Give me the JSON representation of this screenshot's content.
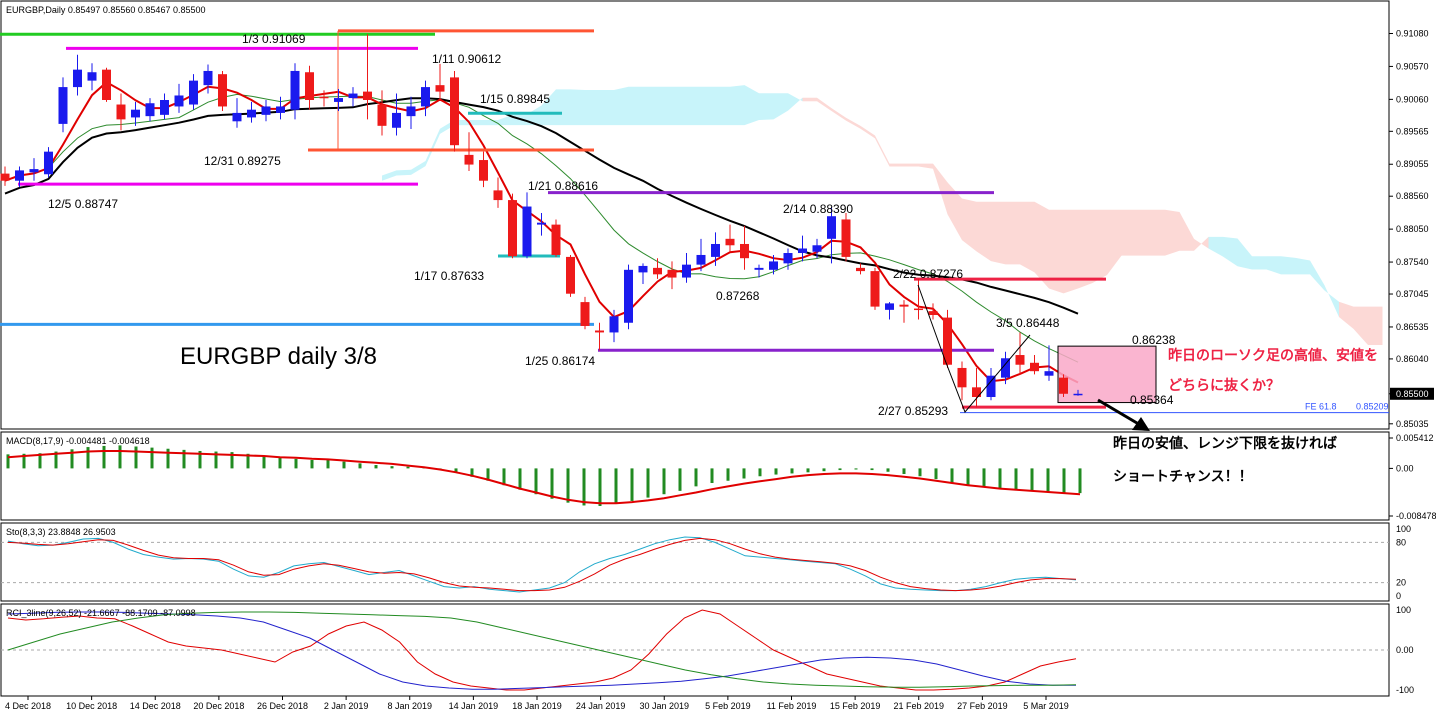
{
  "chart_data": {
    "type": "candlestick",
    "symbol_header": "EURGBP,Daily  0.85497 0.85560 0.85467 0.85500",
    "title": "EURGBP daily 3/8",
    "last_price": "0.85500",
    "price_axis_ticks": [
      "0.91080",
      "0.90570",
      "0.90060",
      "0.89565",
      "0.89055",
      "0.88560",
      "0.88050",
      "0.87540",
      "0.87045",
      "0.86535",
      "0.86040",
      "0.85500",
      "0.85035"
    ],
    "price_range": [
      0.8497,
      0.9132
    ],
    "date_labels": [
      "4 Dec 2018",
      "10 Dec 2018",
      "14 Dec 2018",
      "20 Dec 2018",
      "26 Dec 2018",
      "2 Jan 2019",
      "8 Jan 2019",
      "14 Jan 2019",
      "18 Jan 2019",
      "24 Jan 2019",
      "30 Jan 2019",
      "5 Feb 2019",
      "11 Feb 2019",
      "15 Feb 2019",
      "21 Feb 2019",
      "27 Feb 2019",
      "5 Mar 2019"
    ],
    "candles": [
      {
        "o": 0.8891,
        "h": 0.8902,
        "l": 0.8872,
        "c": 0.888
      },
      {
        "o": 0.888,
        "h": 0.8902,
        "l": 0.887,
        "c": 0.8896
      },
      {
        "o": 0.8893,
        "h": 0.8915,
        "l": 0.888,
        "c": 0.8898
      },
      {
        "o": 0.889,
        "h": 0.8932,
        "l": 0.8885,
        "c": 0.8925
      },
      {
        "o": 0.8968,
        "h": 0.904,
        "l": 0.8955,
        "c": 0.9025
      },
      {
        "o": 0.9025,
        "h": 0.9075,
        "l": 0.9012,
        "c": 0.9052
      },
      {
        "o": 0.9035,
        "h": 0.9062,
        "l": 0.902,
        "c": 0.9048
      },
      {
        "o": 0.9052,
        "h": 0.9055,
        "l": 0.9002,
        "c": 0.9005
      },
      {
        "o": 0.8998,
        "h": 0.9015,
        "l": 0.8958,
        "c": 0.8975
      },
      {
        "o": 0.8978,
        "h": 0.9002,
        "l": 0.8965,
        "c": 0.899
      },
      {
        "o": 0.898,
        "h": 0.9008,
        "l": 0.8972,
        "c": 0.9
      },
      {
        "o": 0.8982,
        "h": 0.9015,
        "l": 0.8975,
        "c": 0.9005
      },
      {
        "o": 0.8995,
        "h": 0.903,
        "l": 0.8985,
        "c": 0.9012
      },
      {
        "o": 0.8998,
        "h": 0.9045,
        "l": 0.899,
        "c": 0.9035
      },
      {
        "o": 0.9028,
        "h": 0.906,
        "l": 0.9015,
        "c": 0.905
      },
      {
        "o": 0.9045,
        "h": 0.905,
        "l": 0.8988,
        "c": 0.8995
      },
      {
        "o": 0.8972,
        "h": 0.9008,
        "l": 0.8962,
        "c": 0.8985
      },
      {
        "o": 0.8978,
        "h": 0.9002,
        "l": 0.897,
        "c": 0.899
      },
      {
        "o": 0.8982,
        "h": 0.9005,
        "l": 0.8972,
        "c": 0.8995
      },
      {
        "o": 0.8985,
        "h": 0.901,
        "l": 0.8975,
        "c": 0.8995
      },
      {
        "o": 0.899,
        "h": 0.9062,
        "l": 0.8975,
        "c": 0.905
      },
      {
        "o": 0.9048,
        "h": 0.9058,
        "l": 0.899,
        "c": 0.9005
      },
      {
        "o": 0.901,
        "h": 0.902,
        "l": 0.8995,
        "c": 0.9008
      },
      {
        "o": 0.9002,
        "h": 0.9022,
        "l": 0.8988,
        "c": 0.9008
      },
      {
        "o": 0.9008,
        "h": 0.9025,
        "l": 0.8995,
        "c": 0.9015
      },
      {
        "o": 0.9018,
        "h": 0.9107,
        "l": 0.8975,
        "c": 0.9005
      },
      {
        "o": 0.8998,
        "h": 0.902,
        "l": 0.895,
        "c": 0.8965
      },
      {
        "o": 0.8962,
        "h": 0.9015,
        "l": 0.895,
        "c": 0.8985
      },
      {
        "o": 0.898,
        "h": 0.901,
        "l": 0.896,
        "c": 0.8995
      },
      {
        "o": 0.8995,
        "h": 0.9035,
        "l": 0.898,
        "c": 0.9025
      },
      {
        "o": 0.9028,
        "h": 0.9061,
        "l": 0.9005,
        "c": 0.9018
      },
      {
        "o": 0.904,
        "h": 0.905,
        "l": 0.8925,
        "c": 0.8935
      },
      {
        "o": 0.892,
        "h": 0.8955,
        "l": 0.8895,
        "c": 0.8905
      },
      {
        "o": 0.8912,
        "h": 0.8925,
        "l": 0.887,
        "c": 0.888
      },
      {
        "o": 0.8865,
        "h": 0.8885,
        "l": 0.8838,
        "c": 0.885
      },
      {
        "o": 0.885,
        "h": 0.886,
        "l": 0.876,
        "c": 0.8763
      },
      {
        "o": 0.8763,
        "h": 0.8862,
        "l": 0.876,
        "c": 0.884
      },
      {
        "o": 0.8812,
        "h": 0.883,
        "l": 0.8795,
        "c": 0.8815
      },
      {
        "o": 0.8812,
        "h": 0.882,
        "l": 0.8762,
        "c": 0.8765
      },
      {
        "o": 0.8762,
        "h": 0.8765,
        "l": 0.87,
        "c": 0.8705
      },
      {
        "o": 0.8692,
        "h": 0.87,
        "l": 0.865,
        "c": 0.8655
      },
      {
        "o": 0.8648,
        "h": 0.866,
        "l": 0.8617,
        "c": 0.8645
      },
      {
        "o": 0.8645,
        "h": 0.868,
        "l": 0.863,
        "c": 0.867
      },
      {
        "o": 0.866,
        "h": 0.875,
        "l": 0.865,
        "c": 0.8742
      },
      {
        "o": 0.8738,
        "h": 0.8752,
        "l": 0.872,
        "c": 0.8748
      },
      {
        "o": 0.8745,
        "h": 0.876,
        "l": 0.8728,
        "c": 0.8735
      },
      {
        "o": 0.8742,
        "h": 0.8755,
        "l": 0.8712,
        "c": 0.873
      },
      {
        "o": 0.873,
        "h": 0.8768,
        "l": 0.8722,
        "c": 0.875
      },
      {
        "o": 0.875,
        "h": 0.879,
        "l": 0.874,
        "c": 0.8765
      },
      {
        "o": 0.8762,
        "h": 0.88,
        "l": 0.8748,
        "c": 0.8782
      },
      {
        "o": 0.879,
        "h": 0.8812,
        "l": 0.877,
        "c": 0.878
      },
      {
        "o": 0.8782,
        "h": 0.881,
        "l": 0.8742,
        "c": 0.876
      },
      {
        "o": 0.8742,
        "h": 0.875,
        "l": 0.873,
        "c": 0.8745
      },
      {
        "o": 0.8742,
        "h": 0.8765,
        "l": 0.8735,
        "c": 0.8755
      },
      {
        "o": 0.8752,
        "h": 0.8775,
        "l": 0.8742,
        "c": 0.8768
      },
      {
        "o": 0.8768,
        "h": 0.8795,
        "l": 0.8755,
        "c": 0.8775
      },
      {
        "o": 0.877,
        "h": 0.879,
        "l": 0.876,
        "c": 0.878
      },
      {
        "o": 0.879,
        "h": 0.8839,
        "l": 0.8752,
        "c": 0.8825
      },
      {
        "o": 0.882,
        "h": 0.883,
        "l": 0.8755,
        "c": 0.8762
      },
      {
        "o": 0.8745,
        "h": 0.8752,
        "l": 0.8735,
        "c": 0.874
      },
      {
        "o": 0.874,
        "h": 0.8745,
        "l": 0.868,
        "c": 0.8685
      },
      {
        "o": 0.868,
        "h": 0.8692,
        "l": 0.8665,
        "c": 0.869
      },
      {
        "o": 0.8688,
        "h": 0.8695,
        "l": 0.866,
        "c": 0.8685
      },
      {
        "o": 0.8682,
        "h": 0.8728,
        "l": 0.8665,
        "c": 0.868
      },
      {
        "o": 0.8678,
        "h": 0.869,
        "l": 0.8665,
        "c": 0.8672
      },
      {
        "o": 0.8668,
        "h": 0.868,
        "l": 0.859,
        "c": 0.8595
      },
      {
        "o": 0.859,
        "h": 0.86,
        "l": 0.854,
        "c": 0.856
      },
      {
        "o": 0.856,
        "h": 0.859,
        "l": 0.8529,
        "c": 0.8545
      },
      {
        "o": 0.8545,
        "h": 0.859,
        "l": 0.854,
        "c": 0.8578
      },
      {
        "o": 0.8575,
        "h": 0.8615,
        "l": 0.8565,
        "c": 0.8605
      },
      {
        "o": 0.861,
        "h": 0.8645,
        "l": 0.858,
        "c": 0.8595
      },
      {
        "o": 0.8598,
        "h": 0.861,
        "l": 0.858,
        "c": 0.8585
      },
      {
        "o": 0.8578,
        "h": 0.8625,
        "l": 0.857,
        "c": 0.8585
      },
      {
        "o": 0.8575,
        "h": 0.858,
        "l": 0.8545,
        "c": 0.855
      },
      {
        "o": 0.855,
        "h": 0.8556,
        "l": 0.8547,
        "c": 0.855
      }
    ],
    "levels": [
      {
        "label": "1/3 0.91069",
        "price": 0.91069,
        "color": "#22cc22"
      },
      {
        "label": "1/11 0.90612",
        "price": 0.90612,
        "color": "#ff5533"
      },
      {
        "label": "12/31 0.89275",
        "price": 0.89275,
        "color": "#ff5533"
      },
      {
        "label": "12/5 0.88747",
        "price": 0.88747,
        "color": "#ee00ee"
      },
      {
        "label": "1/15 0.89845",
        "price": 0.89845,
        "color": "#22bbbb"
      },
      {
        "label": "1/21 0.88616",
        "price": 0.88616,
        "color": "#8822cc"
      },
      {
        "label": "1/17 0.87633",
        "price": 0.87633,
        "color": "#22bbbb"
      },
      {
        "label": "1/25 0.86174",
        "price": 0.86174,
        "color": "#8822cc"
      },
      {
        "label": "2/14 0.88390",
        "price": 0.8839,
        "color": "#000000"
      },
      {
        "label": "0.87268",
        "price": 0.87268,
        "color": "#000000"
      },
      {
        "label": "2/22 0.87276",
        "price": 0.87276,
        "color": "#ee2244"
      },
      {
        "label": "3/5 0.86448",
        "price": 0.86448,
        "color": "#000000"
      },
      {
        "label": "0.86238",
        "price": 0.86238,
        "color": "#000000"
      },
      {
        "label": "0.85364",
        "price": 0.85364,
        "color": "#000000"
      },
      {
        "label": "2/27 0.85293",
        "price": 0.85293,
        "color": "#ee2244"
      }
    ],
    "fe_label": "FE 61.8",
    "fe_value": "0.85209",
    "annotation_jp_1": "昨日のローソク足の高値、安値を",
    "annotation_jp_2": "どちらに抜くか？",
    "annotation_jp_3": "昨日の安値、レンジ下限を抜ければ",
    "annotation_jp_4": "ショートチャンス！！",
    "macd": {
      "header": "MACD(8,17,9) -0.004481 -0.004618",
      "ticks": [
        "0.005412",
        "0.00",
        "-0.008478"
      ],
      "hist": [
        0.0025,
        0.0026,
        0.0027,
        0.003,
        0.0034,
        0.0038,
        0.004,
        0.0041,
        0.0039,
        0.0037,
        0.0035,
        0.0033,
        0.0031,
        0.003,
        0.0029,
        0.0026,
        0.0022,
        0.0019,
        0.0017,
        0.0015,
        0.0015,
        0.0012,
        0.0009,
        0.0006,
        0.0004,
        0.0003,
        0.0001,
        -0.0003,
        -0.0008,
        -0.0015,
        -0.0022,
        -0.003,
        -0.0038,
        -0.0046,
        -0.0054,
        -0.0061,
        -0.0066,
        -0.0067,
        -0.0063,
        -0.0058,
        -0.0052,
        -0.0046,
        -0.004,
        -0.0032,
        -0.0026,
        -0.0022,
        -0.0018,
        -0.0014,
        -0.0011,
        -0.0009,
        -0.0007,
        -0.0005,
        -0.0003,
        -0.0002,
        -0.0003,
        -0.0006,
        -0.001,
        -0.0014,
        -0.0019,
        -0.0025,
        -0.003,
        -0.0033,
        -0.0035,
        -0.0037,
        -0.0039,
        -0.0041,
        -0.0043,
        -0.0044
      ],
      "signal": [
        0.002,
        0.0022,
        0.0024,
        0.0026,
        0.0028,
        0.003,
        0.0031,
        0.0031,
        0.003,
        0.0029,
        0.0028,
        0.0027,
        0.0026,
        0.0025,
        0.0024,
        0.0023,
        0.0022,
        0.002,
        0.0019,
        0.0017,
        0.0016,
        0.0014,
        0.0012,
        0.001,
        0.0008,
        0.0005,
        0.0002,
        -0.0002,
        -0.0007,
        -0.0013,
        -0.002,
        -0.0028,
        -0.0036,
        -0.0043,
        -0.005,
        -0.0056,
        -0.006,
        -0.0062,
        -0.0062,
        -0.006,
        -0.0057,
        -0.0053,
        -0.0048,
        -0.0043,
        -0.0037,
        -0.0032,
        -0.0027,
        -0.0023,
        -0.0019,
        -0.0015,
        -0.0012,
        -0.001,
        -0.0009,
        -0.0009,
        -0.001,
        -0.0012,
        -0.0015,
        -0.0018,
        -0.0022,
        -0.0026,
        -0.003,
        -0.0033,
        -0.0036,
        -0.0038,
        -0.004,
        -0.0042,
        -0.0044,
        -0.0046
      ]
    },
    "stoch": {
      "header": "Sto(8,3,3) 23.8848 26.9503",
      "ticks": [
        "100",
        "80",
        "20",
        "0"
      ],
      "k": [
        82,
        78,
        75,
        76,
        80,
        85,
        86,
        80,
        70,
        62,
        58,
        55,
        56,
        55,
        52,
        40,
        30,
        28,
        35,
        45,
        48,
        50,
        44,
        38,
        32,
        35,
        38,
        30,
        22,
        14,
        12,
        14,
        10,
        8,
        6,
        9,
        12,
        20,
        36,
        48,
        56,
        62,
        70,
        78,
        84,
        88,
        87,
        80,
        70,
        60,
        58,
        56,
        54,
        52,
        50,
        48,
        40,
        30,
        18,
        12,
        10,
        9,
        8,
        8,
        10,
        14,
        20,
        25,
        27,
        28,
        26,
        24
      ],
      "d": [
        80,
        79,
        77,
        76,
        78,
        81,
        84,
        83,
        76,
        68,
        61,
        57,
        56,
        56,
        54,
        46,
        36,
        31,
        32,
        40,
        45,
        48,
        46,
        41,
        36,
        34,
        35,
        33,
        27,
        20,
        15,
        13,
        12,
        10,
        8,
        8,
        9,
        13,
        22,
        33,
        46,
        55,
        62,
        70,
        77,
        83,
        86,
        84,
        78,
        70,
        63,
        58,
        55,
        53,
        51,
        49,
        45,
        38,
        28,
        20,
        14,
        11,
        9,
        8,
        9,
        11,
        15,
        20,
        24,
        26,
        26,
        25
      ]
    },
    "rci": {
      "header": "RCI_3line(9,26,52) -21.6667 -88.1709 -87.0998",
      "ticks": [
        "100",
        "0.00",
        "-100"
      ],
      "short": [
        80,
        75,
        78,
        82,
        85,
        80,
        78,
        60,
        40,
        20,
        10,
        5,
        0,
        -10,
        -20,
        -30,
        -5,
        10,
        40,
        60,
        70,
        50,
        20,
        -30,
        -60,
        -80,
        -90,
        -95,
        -100,
        -100,
        -95,
        -90,
        -85,
        -80,
        -70,
        -50,
        -10,
        40,
        80,
        100,
        90,
        60,
        30,
        0,
        -20,
        -40,
        -60,
        -70,
        -80,
        -90,
        -95,
        -100,
        -100,
        -98,
        -95,
        -90,
        -80,
        -60,
        -40,
        -30,
        -22
      ],
      "mid": [
        90,
        92,
        94,
        95,
        95,
        94,
        92,
        90,
        88,
        85,
        80,
        70,
        50,
        30,
        0,
        -30,
        -60,
        -80,
        -90,
        -95,
        -98,
        -98,
        -96,
        -94,
        -92,
        -90,
        -88,
        -85,
        -82,
        -78,
        -72,
        -65,
        -55,
        -45,
        -35,
        -25,
        -20,
        -18,
        -20,
        -25,
        -35,
        -50,
        -65,
        -78,
        -85,
        -88,
        -88
      ],
      "long": [
        0,
        20,
        40,
        55,
        70,
        80,
        88,
        92,
        94,
        95,
        95,
        94,
        92,
        90,
        88,
        86,
        84,
        80,
        70,
        55,
        40,
        25,
        10,
        -5,
        -20,
        -35,
        -50,
        -62,
        -72,
        -80,
        -85,
        -88,
        -90,
        -92,
        -93,
        -93,
        -92,
        -90,
        -89,
        -88,
        -88,
        -87
      ]
    }
  }
}
